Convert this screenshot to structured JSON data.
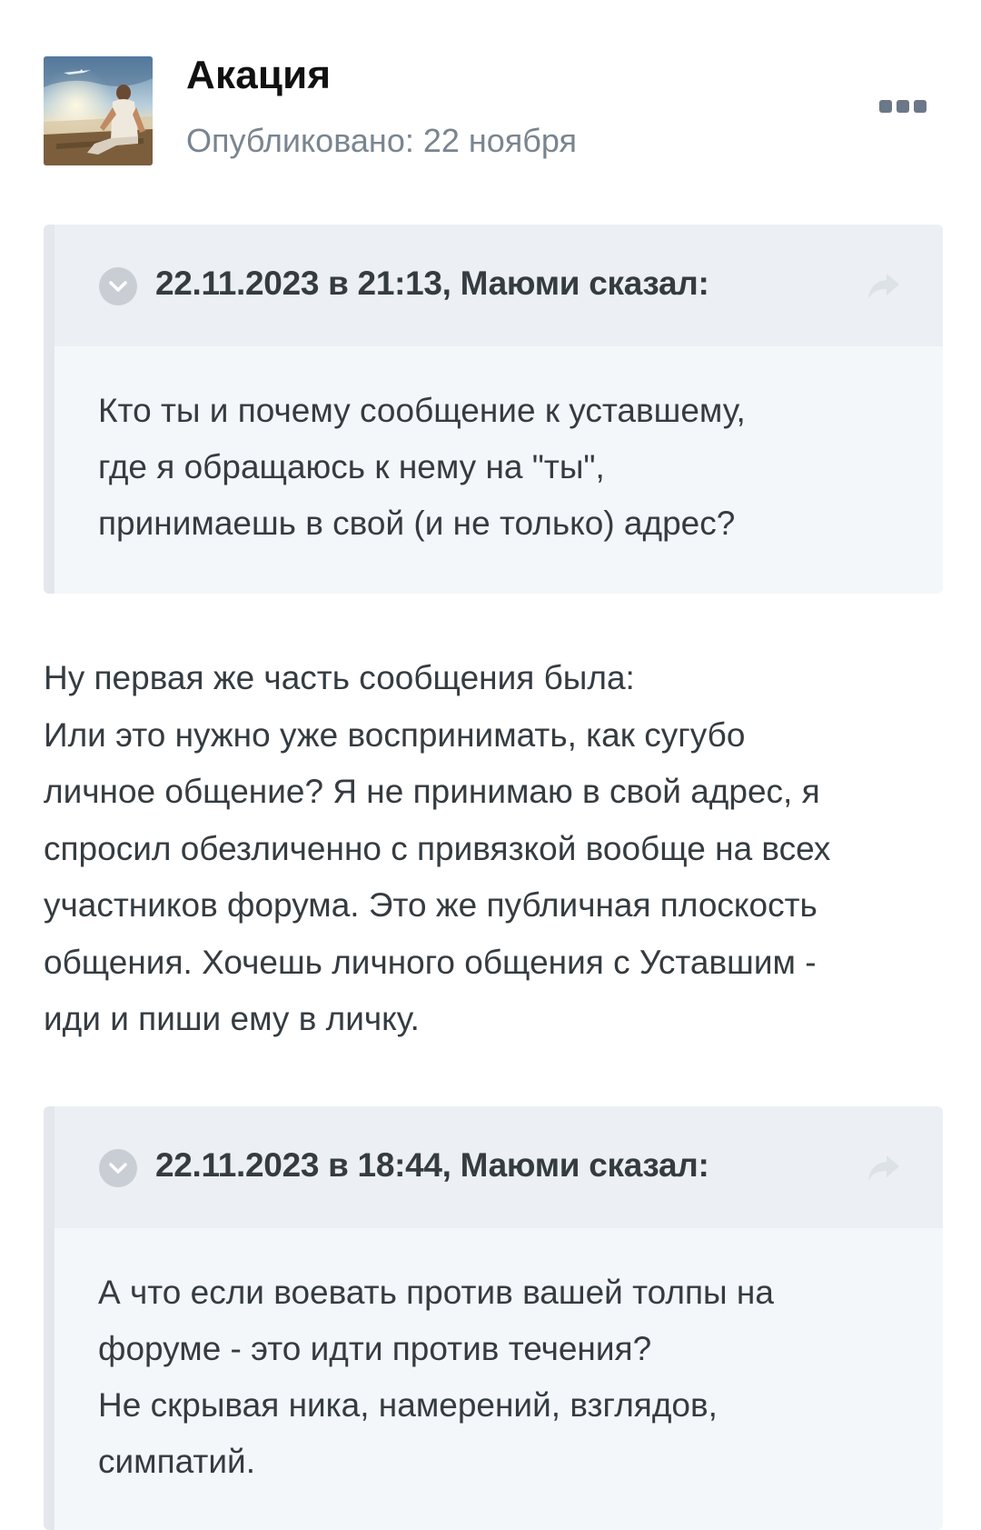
{
  "post": {
    "author": "Акация",
    "published": "Опубликовано: 22 ноября"
  },
  "quotes": [
    {
      "citation": "22.11.2023 в 21:13, Маюми сказал:",
      "lines": [
        "Кто ты и почему сообщение к уставшему,",
        "где я обращаюсь к нему на \"ты\",",
        "принимаешь в свой (и не только) адрес?"
      ]
    },
    {
      "citation": "22.11.2023 в 18:44, Маюми сказал:",
      "lines": [
        "А что если воевать против вашей толпы на",
        "форуме - это идти против течения?",
        "Не скрывая ника, намерений, взглядов,",
        "симпатий."
      ]
    }
  ],
  "reply": {
    "lines": [
      "Ну первая же часть сообщения была:",
      "Или это нужно уже воспринимать, как сугубо",
      "личное общение? Я не принимаю в свой адрес, я",
      "спросил обезличенно с привязкой вообще на всех",
      "участников форума. Это же публичная плоскость",
      "общения. Хочешь личного общения с Уставшим -",
      "иди и пиши ему в личку."
    ]
  },
  "icons": {
    "avatar": "avatar-photo",
    "more": "ellipsis-icon",
    "toggle": "chevron-down-icon",
    "share": "share-arrow-icon"
  },
  "colors": {
    "quote_bg": "#f4f7fa",
    "quote_head_bg": "#eceff3",
    "quote_border": "#e4e8ed",
    "meta_text": "#7a8590",
    "body_text": "#353c41"
  }
}
